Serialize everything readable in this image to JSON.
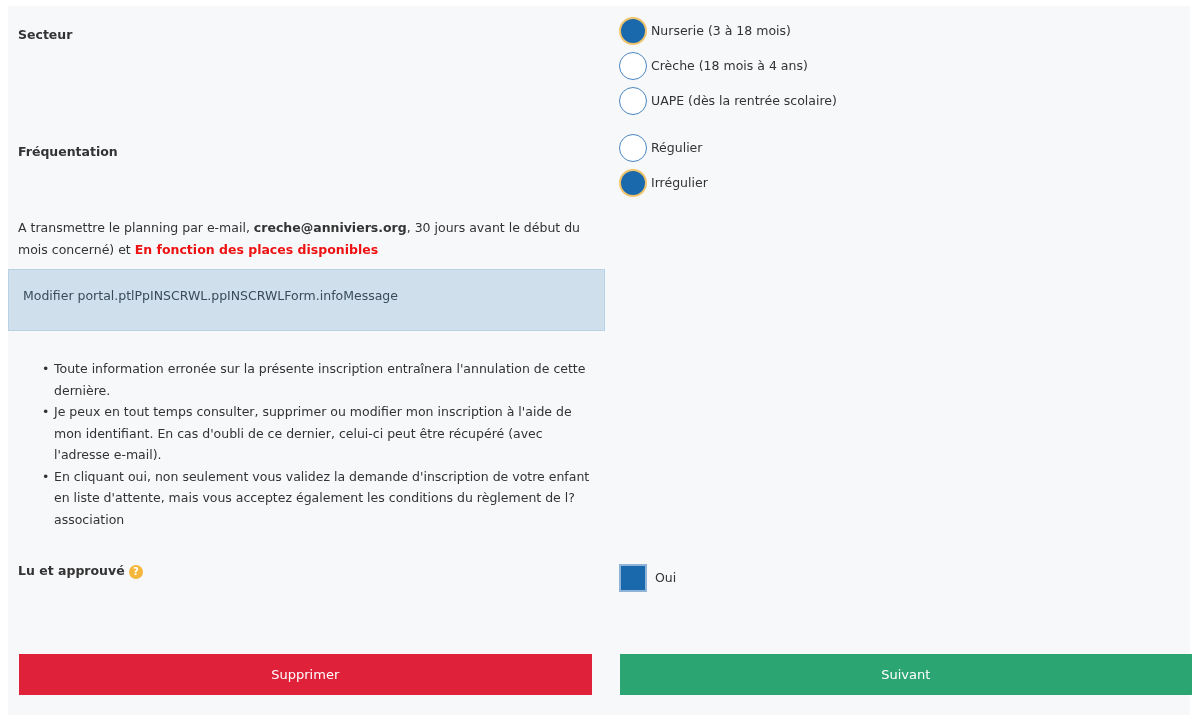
{
  "fields": [
    {
      "label": "Secteur",
      "options": [
        {
          "label": "Nurserie (3 à 18 mois)",
          "selected": true
        },
        {
          "label": "Crèche (18 mois à 4 ans)",
          "selected": false
        },
        {
          "label": "UAPE (dès la rentrée scolaire)",
          "selected": false
        }
      ]
    },
    {
      "label": "Fréquentation",
      "options": [
        {
          "label": "Régulier",
          "selected": false
        },
        {
          "label": "Irrégulier",
          "selected": true
        }
      ]
    }
  ],
  "notice": {
    "text": "A transmettre le planning par e-mail, **creche@anniviers.org**, 30 jours avant le début du mois concerné) et ",
    "highlight": "En fonction des places disponibles"
  },
  "info_message": "Modifier portal.ptlPpINSCRWL.ppINSCRWLForm.infoMessage",
  "conditions": [
    {
      "bullet": "•",
      "text": "Toute information erronée sur la présente inscription entraînera l'annulation de cette dernière."
    },
    {
      "bullet": "•",
      "text": "Je peux en tout temps consulter, supprimer ou modifier mon inscription à l'aide de mon identifiant. En cas d'oubli de ce dernier, celui-ci peut être récupéré (avec l'adresse e-mail)."
    },
    {
      "bullet": "•",
      "text": "En cliquant oui, non seulement vous validez la demande d'inscription de votre enfant en liste d'attente, mais vous acceptez également les conditions du règlement de l?association"
    }
  ],
  "approval": {
    "label": "Lu et approuvé",
    "help_icon": "?",
    "option": "Oui",
    "checked": true
  },
  "buttons": [
    {
      "kind": "danger",
      "label": "Supprimer"
    },
    {
      "kind": "success",
      "label": "Suivant"
    }
  ]
}
